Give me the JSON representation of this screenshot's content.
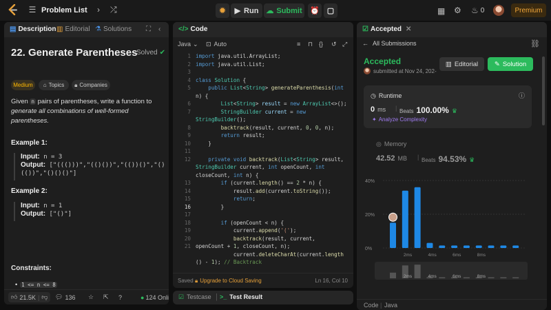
{
  "topbar": {
    "title": "Problem List",
    "run_label": "Run",
    "submit_label": "Submit",
    "streak": "0",
    "premium": "Premium"
  },
  "left": {
    "tabs": [
      {
        "label": "Description"
      },
      {
        "label": "Editorial"
      },
      {
        "label": "Solutions"
      }
    ],
    "problem_title": "22. Generate Parentheses",
    "solved": "Solved",
    "chips": {
      "difficulty": "Medium",
      "topics": "Topics",
      "companies": "Companies"
    },
    "desc": {
      "p1": "Given",
      "n": "n",
      "p2": "pairs of parentheses, write a function to",
      "p3": "generate all combinations of well-formed parentheses."
    },
    "example1": {
      "heading": "Example 1:",
      "input_label": "Input:",
      "input_value": "n = 3",
      "output_label": "Output:",
      "output_value": "[\"((()))\",\"(()())\",\"(())()\",\"()(())\",\"()()()\"]"
    },
    "example2": {
      "heading": "Example 2:",
      "input_label": "Input:",
      "input_value": "n = 1",
      "output_label": "Output:",
      "output_value": "[\"()\"]"
    },
    "constraints_heading": "Constraints:",
    "constraint": "1 <= n <= 8",
    "footer": {
      "likes": "21.5K",
      "comments": "136",
      "online": "124 Onlin"
    }
  },
  "editor": {
    "tab": "Code",
    "language": "Java",
    "auto": "Auto",
    "saved": "Saved",
    "upgrade": "Upgrade to Cloud Saving",
    "position": "Ln 16, Col 10",
    "line_numbers": [
      "1",
      "2",
      "3",
      "4",
      "5",
      "",
      "6",
      "7",
      "",
      "8",
      "9",
      "10",
      "11",
      "12",
      "",
      "",
      "13",
      "14",
      "15",
      "16",
      "17",
      "18",
      "19",
      "20",
      "21",
      "",
      "",
      "22"
    ]
  },
  "bottom": {
    "testcase": "Testcase",
    "result": "Test Result"
  },
  "right": {
    "tab": "Accepted",
    "all_submissions": "All Submissions",
    "status": "Accepted",
    "submitted": "submitted at Nov 24, 202-",
    "editorial_btn": "Editorial",
    "solution_btn": "Solution",
    "runtime_label": "Runtime",
    "runtime_value": "0",
    "runtime_unit": "ms",
    "beats_label": "Beats",
    "runtime_beats": "100.00%",
    "analyze": "Analyze Complexity",
    "memory_label": "Memory",
    "memory_value": "42.52",
    "memory_unit": "MB",
    "memory_beats": "94.53%",
    "footer": {
      "code": "Code",
      "lang": "Java"
    }
  },
  "chart_data": {
    "type": "bar",
    "ytick_labels": [
      "40%",
      "20%",
      "0%"
    ],
    "ylim": [
      0,
      40
    ],
    "xtick_labels": [
      "2ms",
      "4ms",
      "6ms",
      "8ms"
    ],
    "values": [
      15,
      34,
      36,
      3,
      1.5,
      1.5,
      1.5,
      1.5,
      1.5,
      1.5,
      1.5
    ],
    "color": "#1e88e5",
    "overview_tick_labels": [
      "2ms",
      "4ms",
      "6ms",
      "8ms"
    ]
  }
}
